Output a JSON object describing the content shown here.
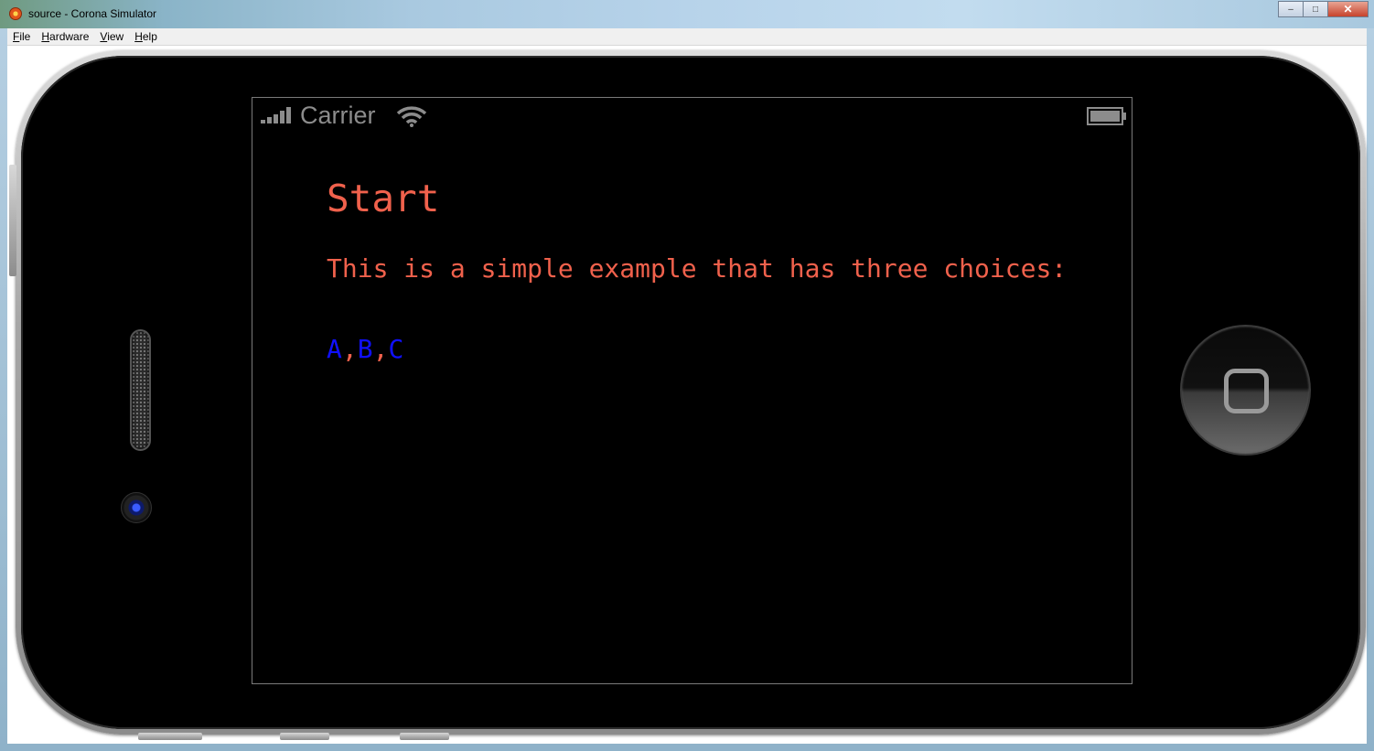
{
  "window": {
    "title": "source - Corona Simulator",
    "controls": {
      "minimize": "–",
      "maximize": "□",
      "close": "✕"
    }
  },
  "menubar": {
    "items": [
      {
        "label": "File",
        "mnemonic": "F",
        "rest": "ile"
      },
      {
        "label": "Hardware",
        "mnemonic": "H",
        "rest": "ardware"
      },
      {
        "label": "View",
        "mnemonic": "V",
        "rest": "iew"
      },
      {
        "label": "Help",
        "mnemonic": "H",
        "rest": "elp"
      }
    ]
  },
  "statusbar": {
    "carrier": "Carrier",
    "icons": [
      "signal-bars-icon",
      "wifi-icon",
      "battery-icon"
    ]
  },
  "app": {
    "title": "Start",
    "body": "This is a simple example that has three choices:",
    "choices": [
      "A",
      "B",
      "C"
    ],
    "separator": ",",
    "colors": {
      "text": "#f0614c",
      "link": "#1010ff",
      "background": "#000000"
    }
  },
  "device": {
    "buttons": [
      "home-button"
    ]
  }
}
